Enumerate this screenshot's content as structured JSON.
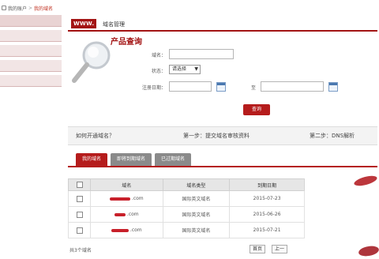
{
  "breadcrumb": {
    "item1": "我的账户",
    "separator": ">",
    "item2": "我的域名"
  },
  "header": {
    "logo": "WWW.",
    "title": "域名管理"
  },
  "query": {
    "title": "产品查询",
    "domain_label": "域名：",
    "status_label": "状态：",
    "status_value": "请选择",
    "date_label": "注册日期：",
    "to_label": "至",
    "submit_label": "查询"
  },
  "steps": {
    "question": "如何开通域名？",
    "step1": "第一步：提交域名审核资料",
    "step2": "第二步：DNS解析"
  },
  "tabs": [
    "我的域名",
    "即将到期域名",
    "已过期域名"
  ],
  "table": {
    "headers": [
      "",
      "域名",
      "域名类型",
      "到期日期"
    ],
    "rows": [
      {
        "domain_suffix": ".com",
        "type": "国际英文域名",
        "expiry": "2015-07-23"
      },
      {
        "domain_suffix": ".com",
        "type": "国际英文域名",
        "expiry": "2015-06-26"
      },
      {
        "domain_suffix": ".com",
        "type": "国际英文域名",
        "expiry": "2015-07-21"
      }
    ]
  },
  "footer": {
    "summary": "共3个域名",
    "first_page": "首页",
    "prev_page": "上一"
  },
  "colors": {
    "accent": "#b51c1c",
    "sidebar_bg": "#f2e5e5"
  },
  "icons": {
    "search_graphic": "magnifier-icon",
    "calendar": "calendar-icon"
  }
}
